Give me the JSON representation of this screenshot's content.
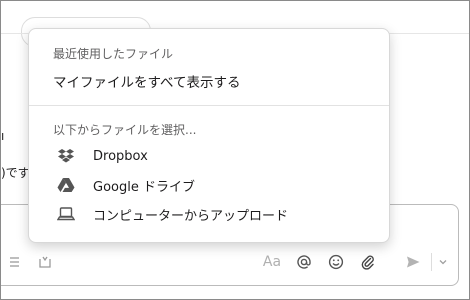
{
  "background": {
    "line1": "ı",
    "line2": ")です"
  },
  "composer": {
    "toolbar": {
      "list_icon": "list-icon",
      "format_icon": "format-icon",
      "text_format_label": "Aa",
      "mention_icon": "at-icon",
      "emoji_icon": "emoji-icon",
      "attach_icon": "paperclip-icon",
      "send_icon": "send-icon",
      "send_options_icon": "chevron-down-icon"
    }
  },
  "menu": {
    "recent_heading": "最近使用したファイル",
    "show_all_label": "マイファイルをすべて表示する",
    "select_heading": "以下からファイルを選択...",
    "sources": [
      {
        "label": "Dropbox",
        "icon": "dropbox-icon"
      },
      {
        "label": "Google ドライブ",
        "icon": "google-drive-icon"
      },
      {
        "label": "コンピューターからアップロード",
        "icon": "laptop-icon"
      }
    ]
  }
}
